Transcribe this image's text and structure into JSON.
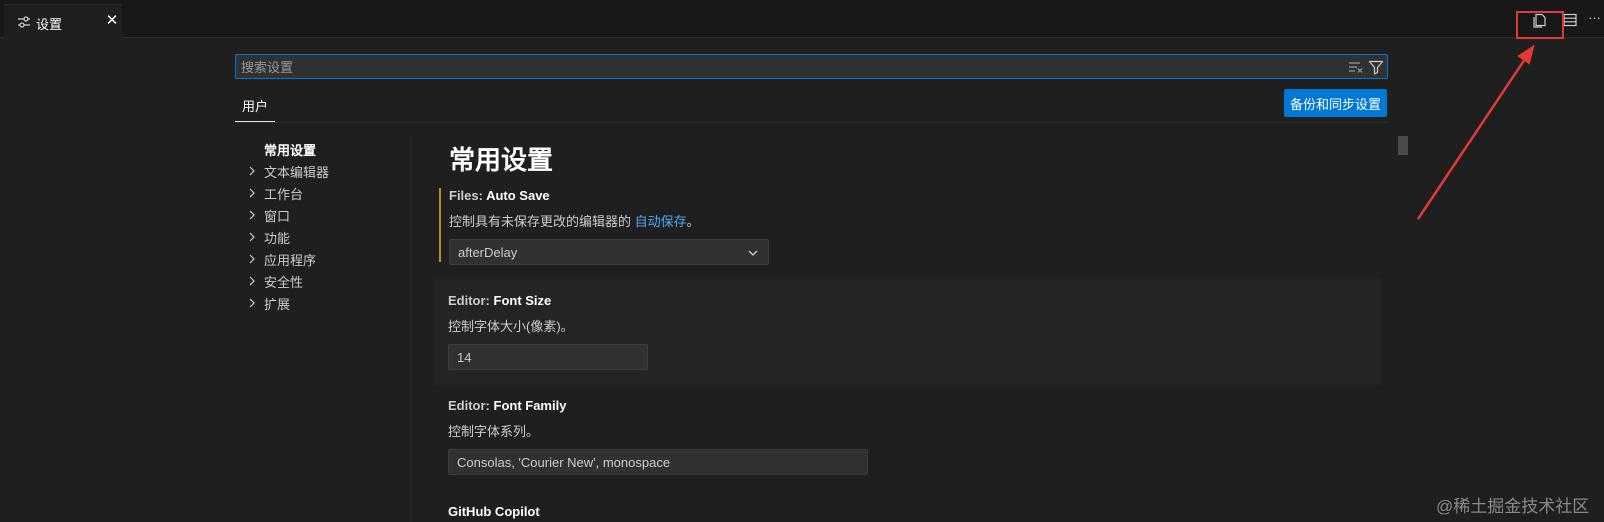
{
  "tab": {
    "label": "设置",
    "close": "✕",
    "icon": "settings-editor-icon"
  },
  "editor_actions": [
    {
      "name": "open-settings-json-icon"
    },
    {
      "name": "split-editor-icon"
    },
    {
      "name": "more-actions-icon",
      "label": "···"
    }
  ],
  "search": {
    "placeholder": "搜索设置",
    "value": ""
  },
  "scope": {
    "tab_label": "用户",
    "sync_button": "备份和同步设置"
  },
  "toc": {
    "active": "常用设置",
    "items": [
      "文本编辑器",
      "工作台",
      "窗口",
      "功能",
      "应用程序",
      "安全性",
      "扩展"
    ]
  },
  "main": {
    "section_title": "常用设置",
    "settings": [
      {
        "category": "Files: ",
        "name": "Auto Save",
        "desc_prefix": "控制具有未保存更改的编辑器的 ",
        "desc_link": "自动保存",
        "desc_suffix": "。",
        "value": "afterDelay"
      },
      {
        "category": "Editor: ",
        "name": "Font Size",
        "desc": "控制字体大小(像素)。",
        "value": "14"
      },
      {
        "category": "Editor: ",
        "name": "Font Family",
        "desc": "控制字体系列。",
        "value": "Consolas, 'Courier New', monospace"
      },
      {
        "title": "GitHub Copilot"
      }
    ]
  },
  "annotation": {
    "color": "#e53935"
  },
  "watermark": "@稀土掘金技术社区",
  "colors": {
    "accent": "#0078d4",
    "link": "#4daafc",
    "modified_indicator": "#b98f2b"
  }
}
